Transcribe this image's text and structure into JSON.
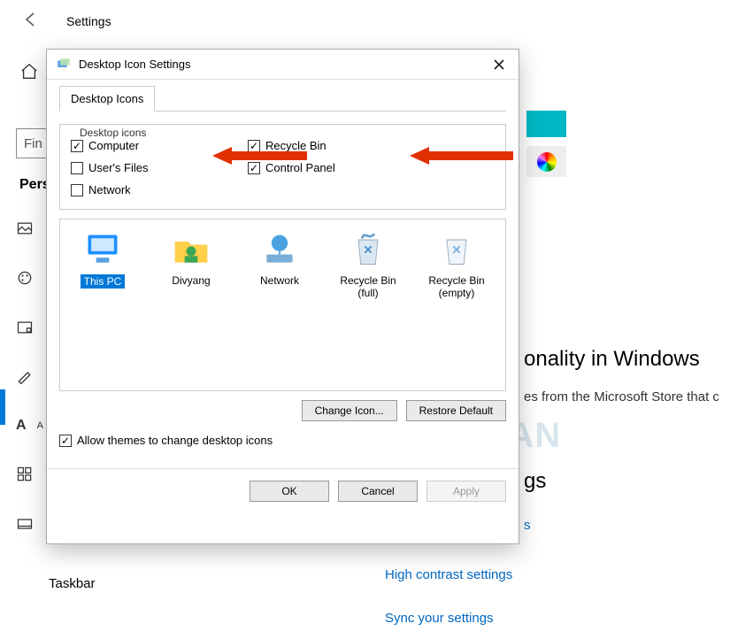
{
  "header": {
    "title": "Settings"
  },
  "sidebar": {
    "search_placeholder": "Fin",
    "section_label": "Pers",
    "taskbar_label": "Taskbar"
  },
  "right_panel": {
    "heading_a_partial": "onality in Windows",
    "subtext_a_partial": "es from the Microsoft Store that c",
    "heading_b_partial": "gs",
    "link_partial": "s",
    "link_contrast": "High contrast settings",
    "link_sync": "Sync your settings"
  },
  "dialog": {
    "title": "Desktop Icon Settings",
    "tab_label": "Desktop Icons",
    "group_label": "Desktop icons",
    "checks": {
      "computer": "Computer",
      "users_files": "User's Files",
      "network": "Network",
      "recycle_bin": "Recycle Bin",
      "control_panel": "Control Panel"
    },
    "icons": {
      "this_pc": "This PC",
      "user": "Divyang",
      "network": "Network",
      "recycle_full": "Recycle Bin (full)",
      "recycle_empty": "Recycle Bin (empty)"
    },
    "change_icon_btn": "Change Icon...",
    "restore_default_btn": "Restore Default",
    "allow_themes": "Allow themes to change desktop icons",
    "ok_btn": "OK",
    "cancel_btn": "Cancel",
    "apply_btn": "Apply"
  },
  "watermark": "MOBIGYAAN"
}
